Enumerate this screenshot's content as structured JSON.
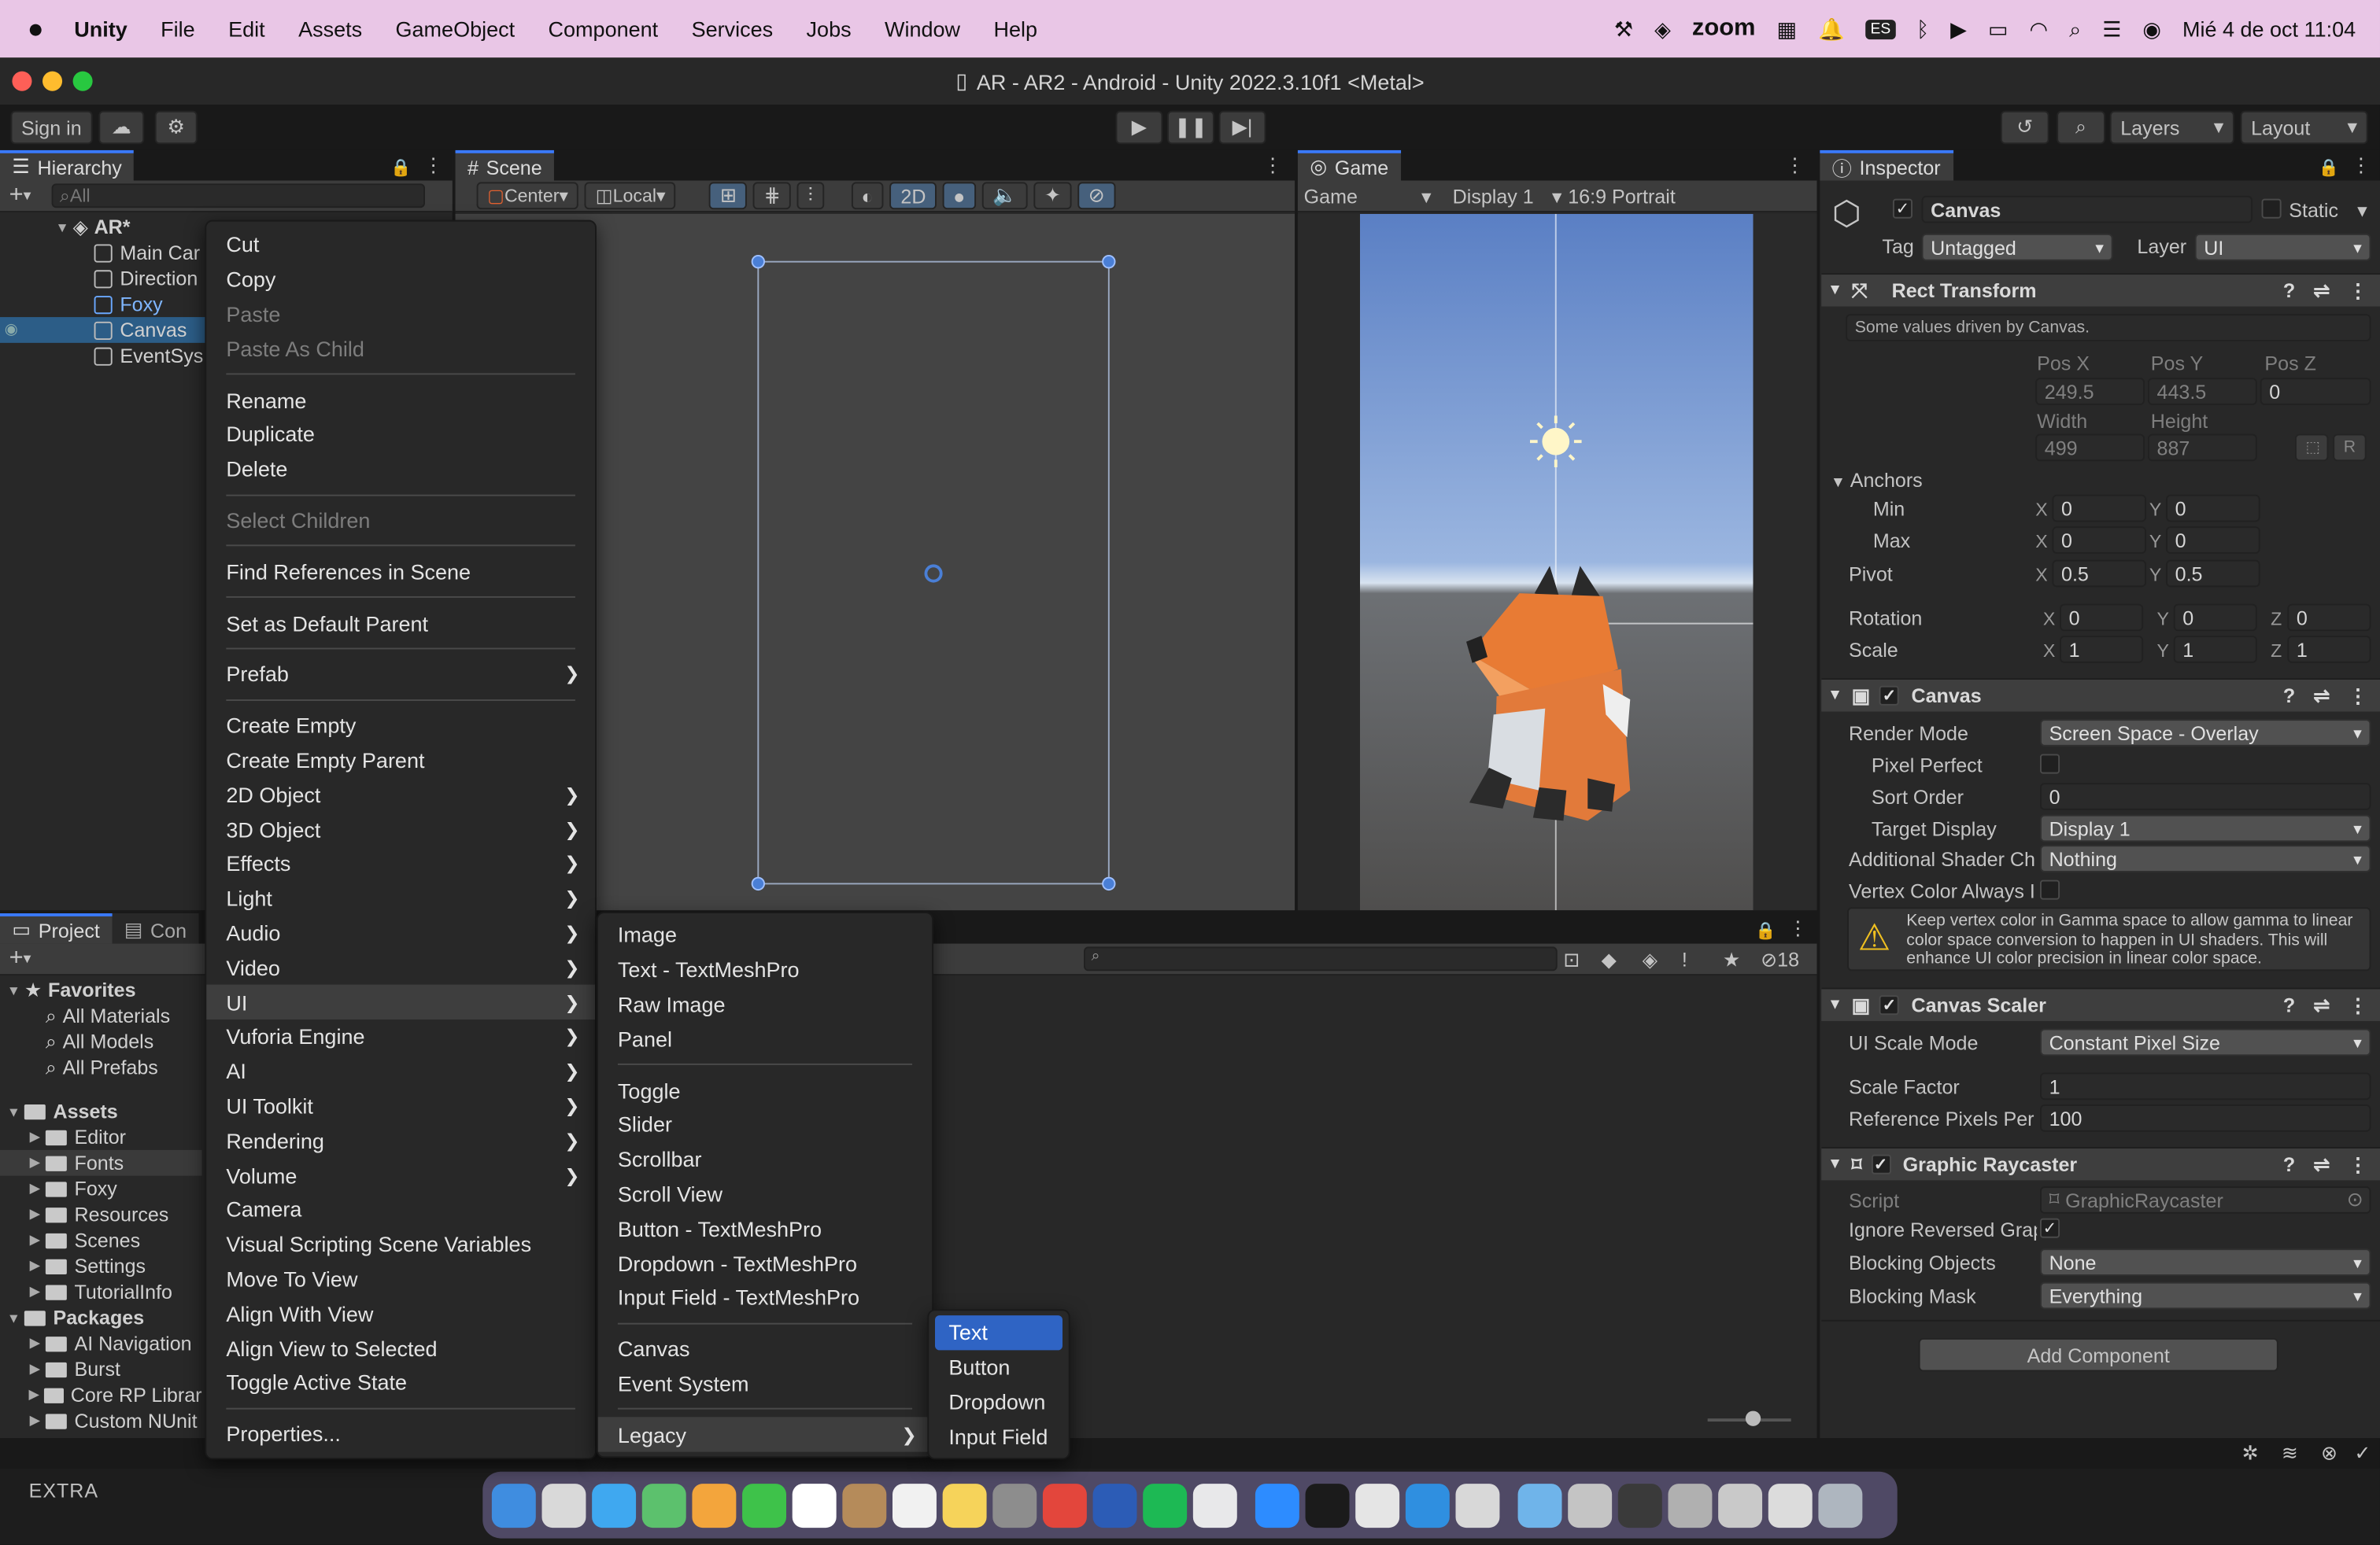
{
  "mac_menubar": {
    "app": "Unity",
    "items": [
      "File",
      "Edit",
      "Assets",
      "GameObject",
      "Component",
      "Services",
      "Jobs",
      "Window",
      "Help"
    ],
    "zoom_label": "zoom",
    "kb_label": "ES",
    "datetime": "Mié 4 de oct  11:04"
  },
  "window": {
    "title": "AR - AR2 - Android - Unity 2022.3.10f1 <Metal>"
  },
  "toolbar": {
    "sign_in": "Sign in",
    "layers": "Layers",
    "layout": "Layout"
  },
  "hierarchy": {
    "tab": "Hierarchy",
    "search_placeholder": "All",
    "root": "AR*",
    "items": [
      "Main Car",
      "Direction",
      "Foxy",
      "Canvas",
      "EventSys"
    ]
  },
  "scene": {
    "tab": "Scene",
    "pivot": "Center",
    "space": "Local",
    "mode_2d": "2D"
  },
  "game": {
    "tab": "Game",
    "mode": "Game",
    "display": "Display 1",
    "aspect": "16:9 Portrait"
  },
  "project": {
    "tab_project": "Project",
    "tab_console": "Con",
    "favorites": "Favorites",
    "fav_items": [
      "All Materials",
      "All Models",
      "All Prefabs"
    ],
    "assets": "Assets",
    "asset_items": [
      "Editor",
      "Fonts",
      "Foxy",
      "Resources",
      "Scenes",
      "Settings",
      "TutorialInfo"
    ],
    "packages": "Packages",
    "package_items": [
      "AI Navigation",
      "Burst",
      "Core RP Librar",
      "Custom NUnit"
    ],
    "hidden_count": "18"
  },
  "context_menu": {
    "items": [
      {
        "label": "Cut"
      },
      {
        "label": "Copy"
      },
      {
        "label": "Paste",
        "disabled": true
      },
      {
        "label": "Paste As Child",
        "disabled": true
      },
      {
        "sep": true
      },
      {
        "label": "Rename"
      },
      {
        "label": "Duplicate"
      },
      {
        "label": "Delete"
      },
      {
        "sep": true
      },
      {
        "label": "Select Children",
        "disabled": true
      },
      {
        "sep": true
      },
      {
        "label": "Find References in Scene"
      },
      {
        "sep": true
      },
      {
        "label": "Set as Default Parent"
      },
      {
        "sep": true
      },
      {
        "label": "Prefab",
        "sub": true
      },
      {
        "sep": true
      },
      {
        "label": "Create Empty"
      },
      {
        "label": "Create Empty Parent"
      },
      {
        "label": "2D Object",
        "sub": true
      },
      {
        "label": "3D Object",
        "sub": true
      },
      {
        "label": "Effects",
        "sub": true
      },
      {
        "label": "Light",
        "sub": true
      },
      {
        "label": "Audio",
        "sub": true
      },
      {
        "label": "Video",
        "sub": true
      },
      {
        "label": "UI",
        "sub": true,
        "hl": true
      },
      {
        "label": "Vuforia Engine",
        "sub": true
      },
      {
        "label": "AI",
        "sub": true
      },
      {
        "label": "UI Toolkit",
        "sub": true
      },
      {
        "label": "Rendering",
        "sub": true
      },
      {
        "label": "Volume",
        "sub": true
      },
      {
        "label": "Camera"
      },
      {
        "label": "Visual Scripting Scene Variables"
      },
      {
        "label": "Move To View"
      },
      {
        "label": "Align With View"
      },
      {
        "label": "Align View to Selected"
      },
      {
        "label": "Toggle Active State"
      },
      {
        "sep": true
      },
      {
        "label": "Properties..."
      }
    ]
  },
  "ui_submenu": {
    "items": [
      {
        "label": "Image"
      },
      {
        "label": "Text - TextMeshPro"
      },
      {
        "label": "Raw Image"
      },
      {
        "label": "Panel"
      },
      {
        "sep": true
      },
      {
        "label": "Toggle"
      },
      {
        "label": "Slider"
      },
      {
        "label": "Scrollbar"
      },
      {
        "label": "Scroll View"
      },
      {
        "label": "Button - TextMeshPro"
      },
      {
        "label": "Dropdown - TextMeshPro"
      },
      {
        "label": "Input Field - TextMeshPro"
      },
      {
        "sep": true
      },
      {
        "label": "Canvas"
      },
      {
        "label": "Event System"
      },
      {
        "sep": true
      },
      {
        "label": "Legacy",
        "sub": true,
        "hl": true
      }
    ]
  },
  "legacy_submenu": {
    "items": [
      {
        "label": "Text",
        "act": true
      },
      {
        "label": "Button"
      },
      {
        "label": "Dropdown"
      },
      {
        "label": "Input Field"
      }
    ]
  },
  "inspector": {
    "tab": "Inspector",
    "object_name": "Canvas",
    "static": "Static",
    "tag_label": "Tag",
    "tag": "Untagged",
    "layer_label": "Layer",
    "layer": "UI",
    "rect": {
      "title": "Rect Transform",
      "note": "Some values driven by Canvas.",
      "posx_l": "Pos X",
      "posy_l": "Pos Y",
      "posz_l": "Pos Z",
      "posx": "249.5",
      "posy": "443.5",
      "posz": "0",
      "width_l": "Width",
      "height_l": "Height",
      "width": "499",
      "height": "887",
      "r_btn": "R",
      "anchors": "Anchors",
      "min": "Min",
      "max": "Max",
      "pivot": "Pivot",
      "rotation": "Rotation",
      "scale": "Scale",
      "min_x": "0",
      "min_y": "0",
      "max_x": "0",
      "max_y": "0",
      "pivot_x": "0.5",
      "pivot_y": "0.5",
      "rot_x": "0",
      "rot_y": "0",
      "rot_z": "0",
      "scale_x": "1",
      "scale_y": "1",
      "scale_z": "1",
      "lx": "X",
      "ly": "Y",
      "lz": "Z"
    },
    "canvas": {
      "title": "Canvas",
      "render_mode_l": "Render Mode",
      "render_mode": "Screen Space - Overlay",
      "pixel_perfect_l": "Pixel Perfect",
      "sort_order_l": "Sort Order",
      "sort_order": "0",
      "target_display_l": "Target Display",
      "target_display": "Display 1",
      "shader_ch_l": "Additional Shader Ch",
      "shader_ch": "Nothing",
      "vertex_color_l": "Vertex Color Always I",
      "warning": "Keep vertex color in Gamma space to allow gamma to linear color space conversion to happen in UI shaders. This will enhance UI color precision in linear color space."
    },
    "scaler": {
      "title": "Canvas Scaler",
      "mode_l": "UI Scale Mode",
      "mode": "Constant Pixel Size",
      "factor_l": "Scale Factor",
      "factor": "1",
      "ref_l": "Reference Pixels Per",
      "ref": "100"
    },
    "raycaster": {
      "title": "Graphic Raycaster",
      "script_l": "Script",
      "script": "GraphicRaycaster",
      "ignore_l": "Ignore Reversed Grap",
      "blocking_l": "Blocking Objects",
      "blocking": "None",
      "mask_l": "Blocking Mask",
      "mask": "Everything"
    },
    "add_component": "Add Component"
  },
  "status": {
    "label": "EXTRA"
  },
  "colors": {
    "accent": "#2f64c4",
    "selection": "#2c5d87",
    "menubar": "#e9c6e6"
  }
}
